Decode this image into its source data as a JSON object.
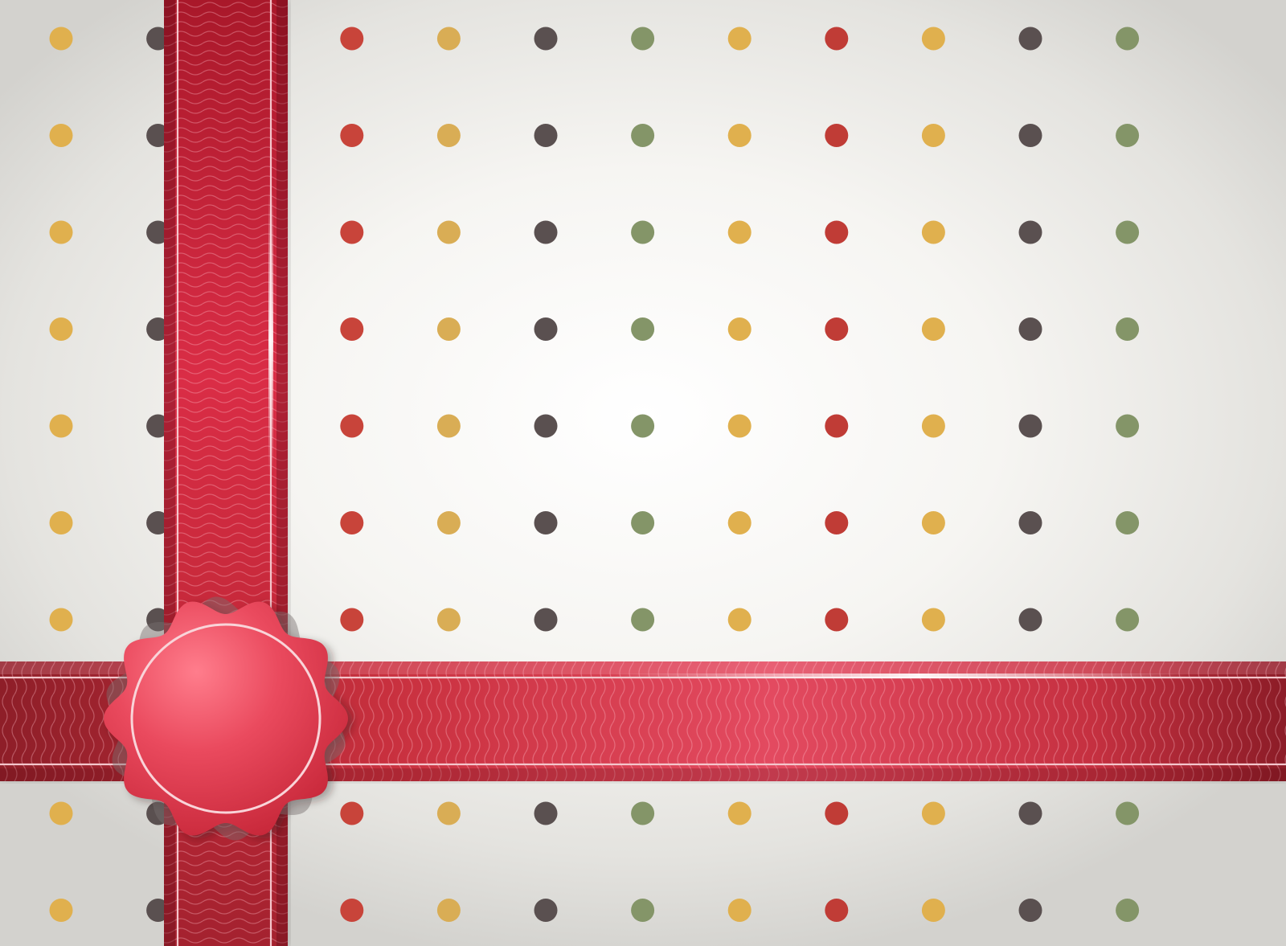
{
  "palette": {
    "dot_colors": [
      "#e0b04e",
      "#5a5050",
      "#e0b04e",
      "#c8443a",
      "#d9ad55",
      "#5a5050",
      "#849568",
      "#e0b04e",
      "#c03c36",
      "#e0b04e",
      "#5a5050",
      "#849568"
    ],
    "ribbon": "#d93345",
    "ribbon_dark": "#8e1e28",
    "seal": "#e8475d",
    "stitch": "#f6d6da"
  },
  "pattern": {
    "columns": 12,
    "rows": 10
  },
  "icons": {
    "seal": "wax-seal-badge",
    "ribbon": "gift-ribbon"
  }
}
